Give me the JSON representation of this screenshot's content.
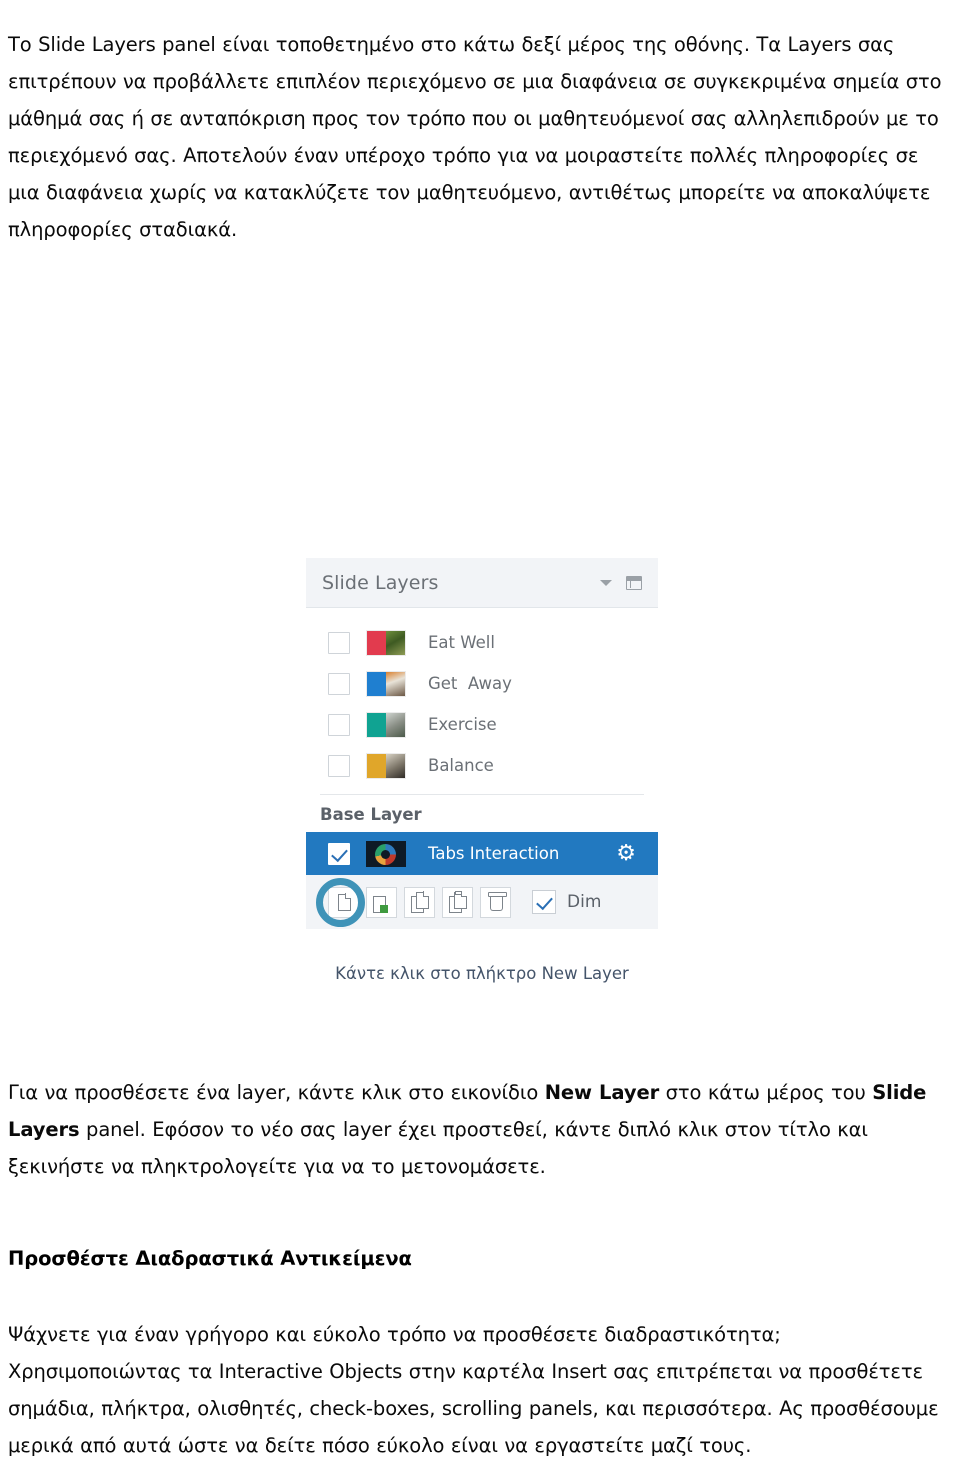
{
  "document": {
    "paragraphs": {
      "intro": "Το Slide Layers panel είναι τοποθετημένο στο κάτω δεξί μέρος της οθόνης. Τα Layers σας επιτρέπουν να προβάλλετε επιπλέον περιεχόμενο σε μια διαφάνεια σε συγκεκριμένα σημεία στο μάθημά σας ή σε ανταπόκριση προς τον τρόπο που οι μαθητευόμενοί σας αλληλεπιδρούν με το περιεχόμενό σας. Αποτελούν έναν υπέροχο τρόπο για να μοιραστείτε πολλές πληροφορίες σε μια διαφάνεια χωρίς να κατακλύζετε τον μαθητευόμενο, αντιθέτως μπορείτε να αποκαλύψετε πληροφορίες σταδιακά.",
      "add_layer_part1": "Για να προσθέσετε ένα layer, κάντε κλικ στο εικονίδιο ",
      "add_layer_bold1": "New Layer",
      "add_layer_part2": " στο κάτω μέρος του ",
      "add_layer_bold2": "Slide Layers",
      "add_layer_part3": " panel. Εφόσον το νέο σας layer έχει προστεθεί, κάντε διπλό κλικ στον τίτλο και ξεκινήστε να πληκτρολογείτε για να το μετονομάσετε.",
      "interactive": "Ψάχνετε για έναν γρήγορο και εύκολο τρόπο να προσθέσετε διαδραστικότητα; Χρησιμοποιώντας τα Interactive Objects στην καρτέλα Insert σας επιτρέπεται να προσθέτετε σημάδια, πλήκτρα, ολισθητές, check-boxes, scrolling panels, και περισσότερα. Ας προσθέσουμε μερικά από αυτά ώστε να δείτε πόσο εύκολο είναι να εργαστείτε μαζί τους."
    },
    "heading_interactive_objects": "Προσθέστε Διαδραστικά Αντικείμενα",
    "figure_caption": "Κάντε κλικ στο πλήκτρο New Layer"
  },
  "slide_layers_panel": {
    "title": "Slide Layers",
    "header_icons": {
      "caret": "chevron-down-icon",
      "window": "panel-window-icon"
    },
    "layers": [
      {
        "name": "Eat Well",
        "checked": false,
        "thumb_color": "#e23b4e"
      },
      {
        "name": "Get  Away",
        "checked": false,
        "thumb_color": "#1f7fd0"
      },
      {
        "name": "Exercise",
        "checked": false,
        "thumb_color": "#10a392"
      },
      {
        "name": "Balance",
        "checked": false,
        "thumb_color": "#e0a62a"
      }
    ],
    "base_layer_label": "Base Layer",
    "base_layer": {
      "name": "Tabs Interaction",
      "checked": true,
      "selected_bg": "#2279c0",
      "gear_icon": "gear-icon"
    },
    "toolbar": {
      "buttons": [
        {
          "name": "New Layer",
          "icon": "new-page-icon",
          "highlighted": true
        },
        {
          "name": "Edit Layer",
          "icon": "edit-page-icon",
          "highlighted": false
        },
        {
          "name": "Copy Layer",
          "icon": "copy-icon",
          "highlighted": false
        },
        {
          "name": "Paste Layer",
          "icon": "paste-icon",
          "highlighted": false
        },
        {
          "name": "Delete Layer",
          "icon": "trash-icon",
          "highlighted": false
        }
      ],
      "dim_label": "Dim",
      "dim_checked": true,
      "highlight_color": "#3f93b8"
    }
  }
}
